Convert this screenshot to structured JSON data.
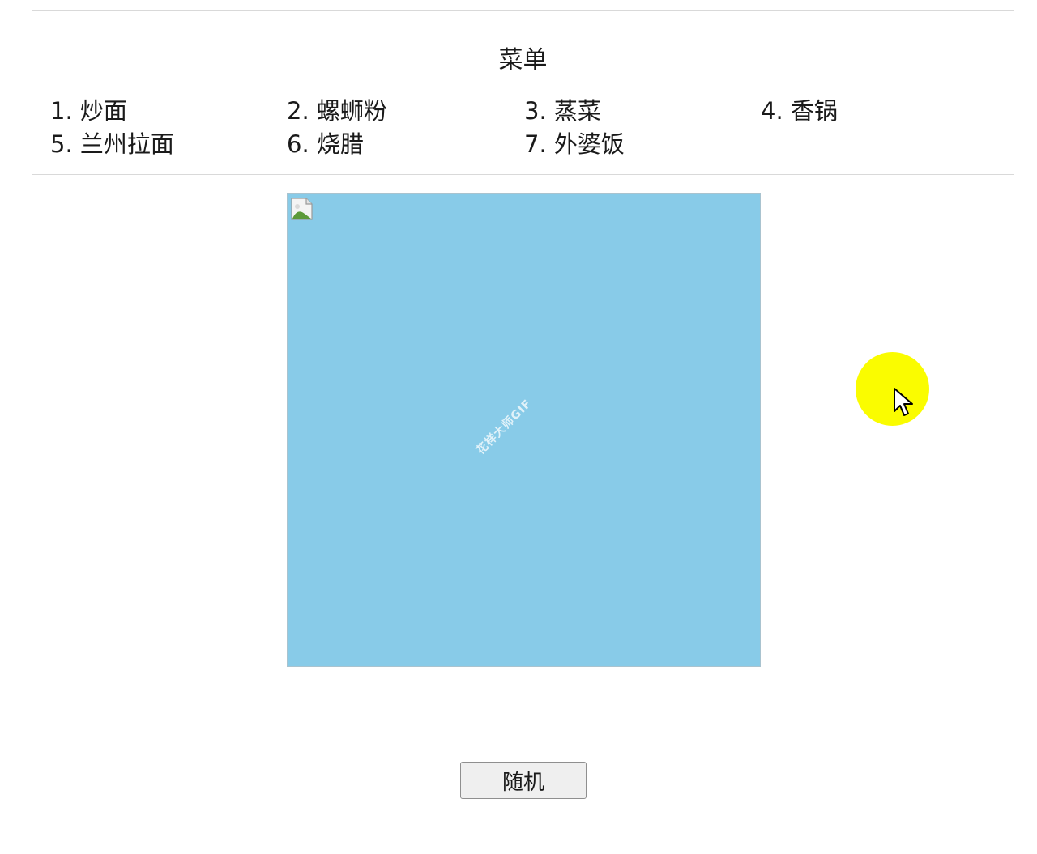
{
  "menu": {
    "title": "菜单",
    "items": [
      {
        "label": "1. 炒面"
      },
      {
        "label": "2. 螺蛳粉"
      },
      {
        "label": "3. 蒸菜"
      },
      {
        "label": "4. 香锅"
      },
      {
        "label": "5. 兰州拉面"
      },
      {
        "label": "6. 烧腊"
      },
      {
        "label": "7. 外婆饭"
      }
    ]
  },
  "image_area": {
    "background_color": "#88cbe8",
    "icon": "broken-image-icon",
    "watermark": "花样大师GIF"
  },
  "cursor": {
    "icon": "pointer-cursor-icon",
    "highlight_color": "#fafc00"
  },
  "actions": {
    "random_label": "随机"
  }
}
